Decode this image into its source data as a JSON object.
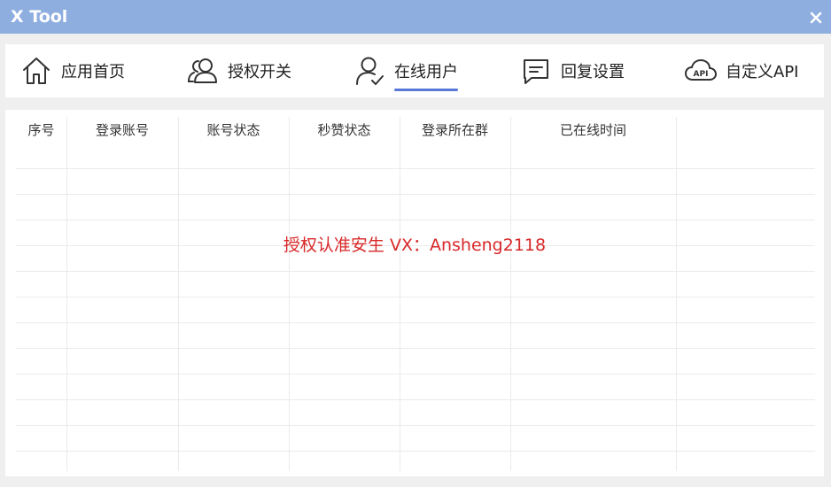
{
  "window": {
    "title": "X Tool"
  },
  "nav": [
    {
      "label": "应用首页",
      "icon": "home-icon",
      "active": false
    },
    {
      "label": "授权开关",
      "icon": "users-icon",
      "active": false
    },
    {
      "label": "在线用户",
      "icon": "user-check-icon",
      "active": true
    },
    {
      "label": "回复设置",
      "icon": "message-icon",
      "active": false
    },
    {
      "label": "自定义API",
      "icon": "cloud-api-icon",
      "active": false
    }
  ],
  "table": {
    "columns": [
      "序号",
      "登录账号",
      "账号状态",
      "秒赞状态",
      "登录所在群",
      "已在线时间"
    ],
    "rows": []
  },
  "watermark": "授权认准安生  VX：Ansheng2118",
  "colors": {
    "titlebar": "#8eaee0",
    "accent": "#5877d6",
    "watermark": "#d92828"
  }
}
